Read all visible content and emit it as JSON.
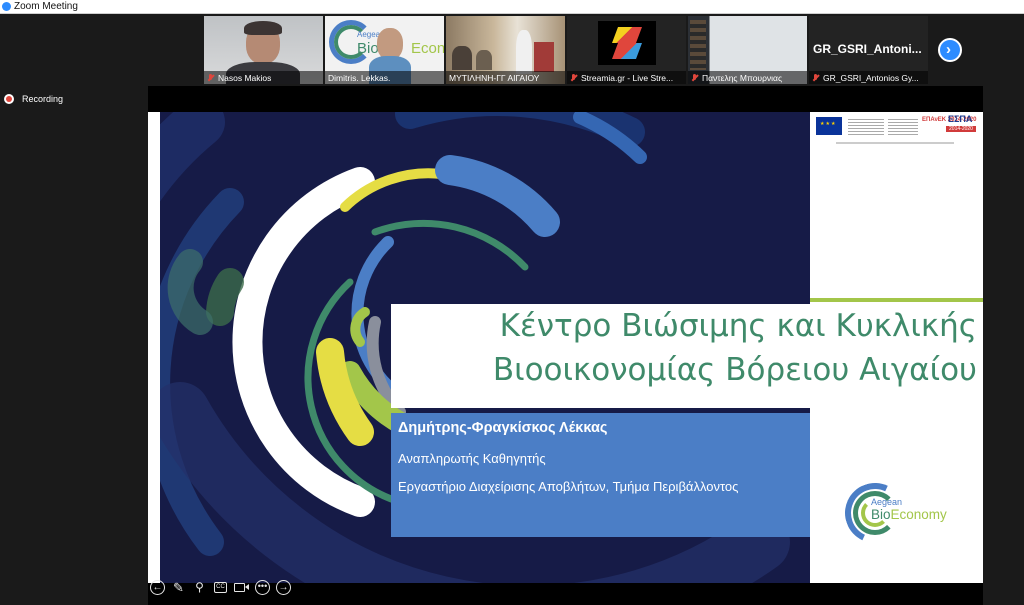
{
  "window": {
    "title": "Zoom Meeting"
  },
  "participants": [
    {
      "name": "Nasos Makios",
      "muted": true
    },
    {
      "name": "Dimitris. Lekkas.",
      "muted": false
    },
    {
      "name": "ΜΥΤΙΛΗΝΗ-ΓΓ ΑΙΓΑΙΟΥ",
      "muted": false
    },
    {
      "name": "Streamia.gr - Live Stre...",
      "muted": true
    },
    {
      "name": "Παντελης Μπουρνιας",
      "muted": true
    },
    {
      "name": "GR_GSRI_Antonios Gy...",
      "muted": true,
      "display_label": "GR_GSRI_Antoni..."
    }
  ],
  "recording": {
    "label": "Recording"
  },
  "slide": {
    "title_line1": "Κέντρο Βιώσιμης και Κυκλικής",
    "title_line2": "Βιοοικονομίας Βόρειου Αιγαίου",
    "author": "Δημήτρης-Φραγκίσκος Λέκκας",
    "role": "Αναπληρωτής Καθηγητής",
    "lab": "Εργαστήριο Διαχείρισης Αποβλήτων, Τμήμα Περιβάλλοντος",
    "logo_small": "Aegean",
    "logo_big_a": "Bio",
    "logo_big_b": "Economy",
    "sponsor_epanek": "ΕΠΑνΕΚ 2014-2020",
    "sponsor_espa": "ΕΣΠΑ",
    "sponsor_espa_years": "2014-2020"
  },
  "tile_bio_logo": {
    "small": "Aegean",
    "big_a": "Bio",
    "big_b": "Economy"
  },
  "toolbar": {
    "cc_label": "CC"
  },
  "colors": {
    "slide_bg": "#161b47",
    "title_green": "#3f8a6a",
    "author_blue": "#4b7ec6",
    "lime": "#a3c64a",
    "zoom_blue": "#2d8cff"
  }
}
